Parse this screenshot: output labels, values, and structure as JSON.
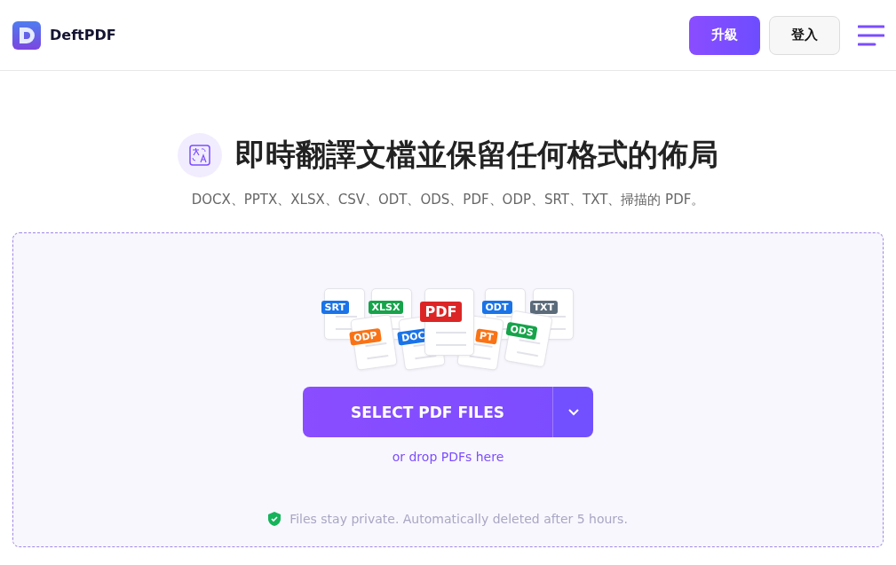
{
  "header": {
    "brand": "DeftPDF",
    "buttons": [
      {
        "label": "升級",
        "kind": "primary"
      },
      {
        "label": "登入",
        "kind": "secondary"
      }
    ]
  },
  "hero": {
    "title": "即時翻譯文檔並保留任何格式的佈局",
    "subtitle": "DOCX、PPTX、XLSX、CSV、ODT、ODS、PDF、ODP、SRT、TXT、掃描的 PDF。"
  },
  "dropzone": {
    "file_types": [
      {
        "label": "SRT",
        "color": "#1a73e8"
      },
      {
        "label": "ODP",
        "color": "#f97316"
      },
      {
        "label": "XLSX",
        "color": "#16a34a"
      },
      {
        "label": "DOC",
        "color": "#1a73e8"
      },
      {
        "label": "PDF",
        "color": "#dc2626"
      },
      {
        "label": "PT",
        "color": "#f97316"
      },
      {
        "label": "ODT",
        "color": "#1a73e8"
      },
      {
        "label": "ODS",
        "color": "#16a34a"
      },
      {
        "label": "TXT",
        "color": "#5b6b7a"
      }
    ],
    "select_button": "SELECT PDF FILES",
    "drop_hint": "or drop PDFs here",
    "privacy_note": "Files stay private. Automatically deleted after 5 hours."
  }
}
